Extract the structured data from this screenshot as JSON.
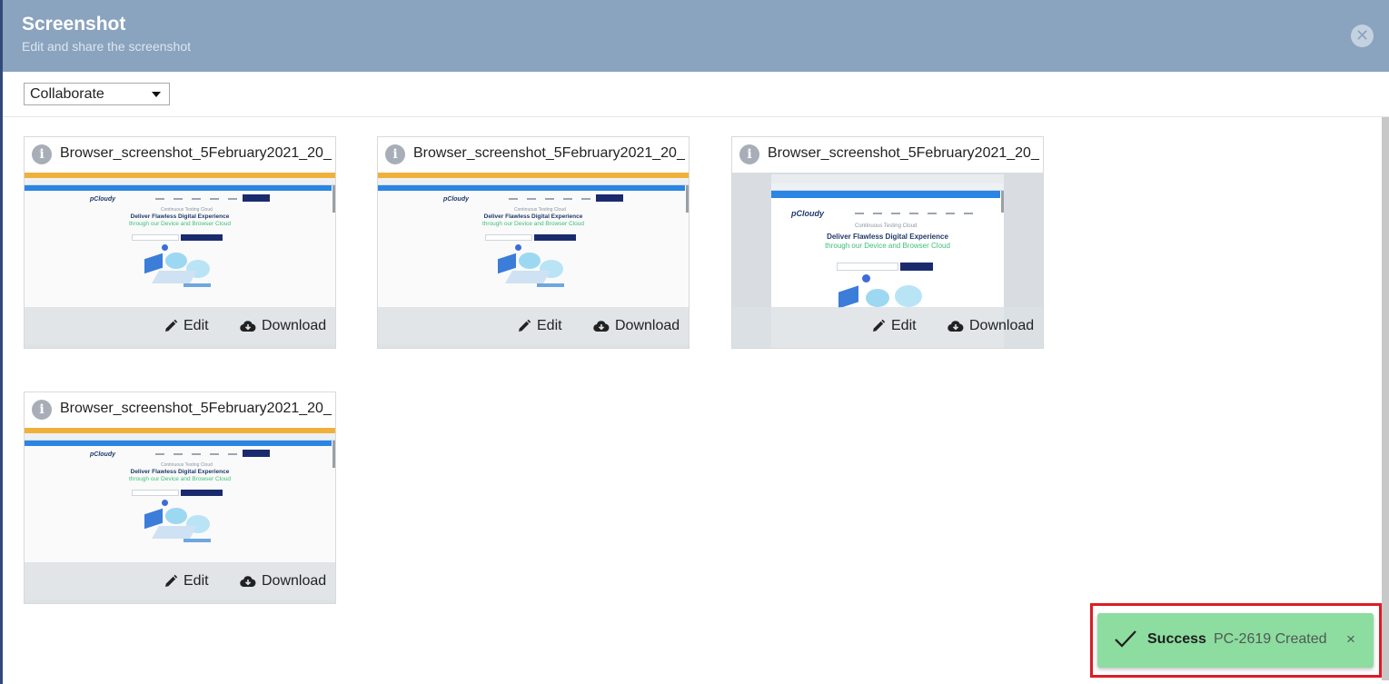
{
  "header": {
    "title": "Screenshot",
    "subtitle": "Edit and share the screenshot",
    "close_symbol": "✕"
  },
  "toolbar": {
    "select_value": "Collaborate"
  },
  "cards": [
    {
      "filename": "Browser_screenshot_5February2021_20_...",
      "edit_label": "Edit",
      "download_label": "Download"
    },
    {
      "filename": "Browser_screenshot_5February2021_20_...",
      "edit_label": "Edit",
      "download_label": "Download"
    },
    {
      "filename": "Browser_screenshot_5February2021_20_...",
      "edit_label": "Edit",
      "download_label": "Download"
    },
    {
      "filename": "Browser_screenshot_5February2021_20_...",
      "edit_label": "Edit",
      "download_label": "Download"
    }
  ],
  "thumbnail_text": {
    "logo": "pCloudy",
    "tagline": "Continuous Testing Cloud",
    "headline": "Deliver Flawless Digital Experience",
    "subheadline": "through our Device and Browser Cloud"
  },
  "toast": {
    "title": "Success",
    "message": "PC-2619 Created",
    "close_symbol": "×"
  },
  "colors": {
    "header_bg": "#8aa3be",
    "toast_bg": "#8ddca0",
    "highlight_border": "#dd1c24"
  },
  "icons": {
    "info": "info-icon",
    "edit": "pencil-icon",
    "download": "cloud-download-icon",
    "close": "close-icon",
    "check": "check-icon"
  }
}
